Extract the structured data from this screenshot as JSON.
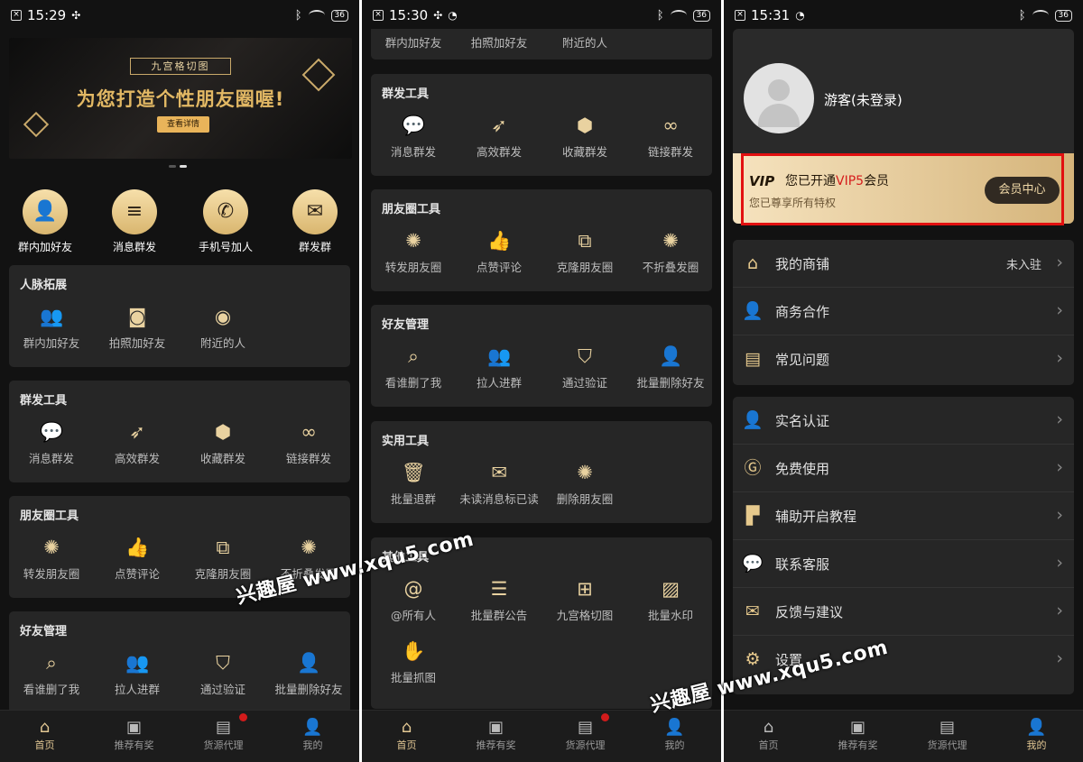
{
  "panel1": {
    "status": {
      "time": "15:29",
      "battery": "36"
    },
    "banner": {
      "top": "九宫格切图",
      "headline": "为您打造个性朋友圈喔!",
      "button": "查看详情"
    },
    "top_icons": [
      "群内加好友",
      "消息群发",
      "手机号加人",
      "群发群"
    ],
    "sections": [
      {
        "title": "人脉拓展",
        "items": [
          "群内加好友",
          "拍照加好友",
          "附近的人"
        ]
      },
      {
        "title": "群发工具",
        "items": [
          "消息群发",
          "高效群发",
          "收藏群发",
          "链接群发"
        ]
      },
      {
        "title": "朋友圈工具",
        "items": [
          "转发朋友圈",
          "点赞评论",
          "克隆朋友圈",
          "不折叠发圈"
        ]
      },
      {
        "title": "好友管理",
        "items": [
          "看谁删了我",
          "拉人进群",
          "通过验证",
          "批量删除好友"
        ]
      }
    ]
  },
  "panel2": {
    "status": {
      "time": "15:30",
      "battery": "36"
    },
    "partial_items": [
      "群内加好友",
      "拍照加好友",
      "附近的人"
    ],
    "sections": [
      {
        "title": "群发工具",
        "items": [
          "消息群发",
          "高效群发",
          "收藏群发",
          "链接群发"
        ]
      },
      {
        "title": "朋友圈工具",
        "items": [
          "转发朋友圈",
          "点赞评论",
          "克隆朋友圈",
          "不折叠发圈"
        ]
      },
      {
        "title": "好友管理",
        "items": [
          "看谁删了我",
          "拉人进群",
          "通过验证",
          "批量删除好友"
        ]
      },
      {
        "title": "实用工具",
        "items": [
          "批量退群",
          "未读消息标已读",
          "删除朋友圈"
        ]
      },
      {
        "title": "其他工具",
        "items": [
          "@所有人",
          "批量群公告",
          "九宫格切图",
          "批量水印",
          "批量抓图"
        ]
      }
    ]
  },
  "panel3": {
    "status": {
      "time": "15:31",
      "battery": "36"
    },
    "user": {
      "name": "游客(未登录)"
    },
    "vip": {
      "badge": "VIP",
      "text_pre": "您已开通",
      "level": "VIP5",
      "text_post": "会员",
      "sub": "您已尊享所有特权",
      "button": "会员中心"
    },
    "menu1": [
      {
        "label": "我的商铺",
        "value": "未入驻"
      },
      {
        "label": "商务合作",
        "value": ""
      },
      {
        "label": "常见问题",
        "value": ""
      }
    ],
    "menu2": [
      {
        "label": "实名认证"
      },
      {
        "label": "免费使用"
      },
      {
        "label": "辅助开启教程"
      },
      {
        "label": "联系客服"
      },
      {
        "label": "反馈与建议"
      },
      {
        "label": "设置"
      }
    ]
  },
  "nav": [
    "首页",
    "推荐有奖",
    "货源代理",
    "我的"
  ],
  "watermark": "兴趣屋 www.xqu5.com",
  "colors": {
    "gold": "#e3c894",
    "vip_red": "#d61d1d",
    "highlight": "#e21010"
  }
}
